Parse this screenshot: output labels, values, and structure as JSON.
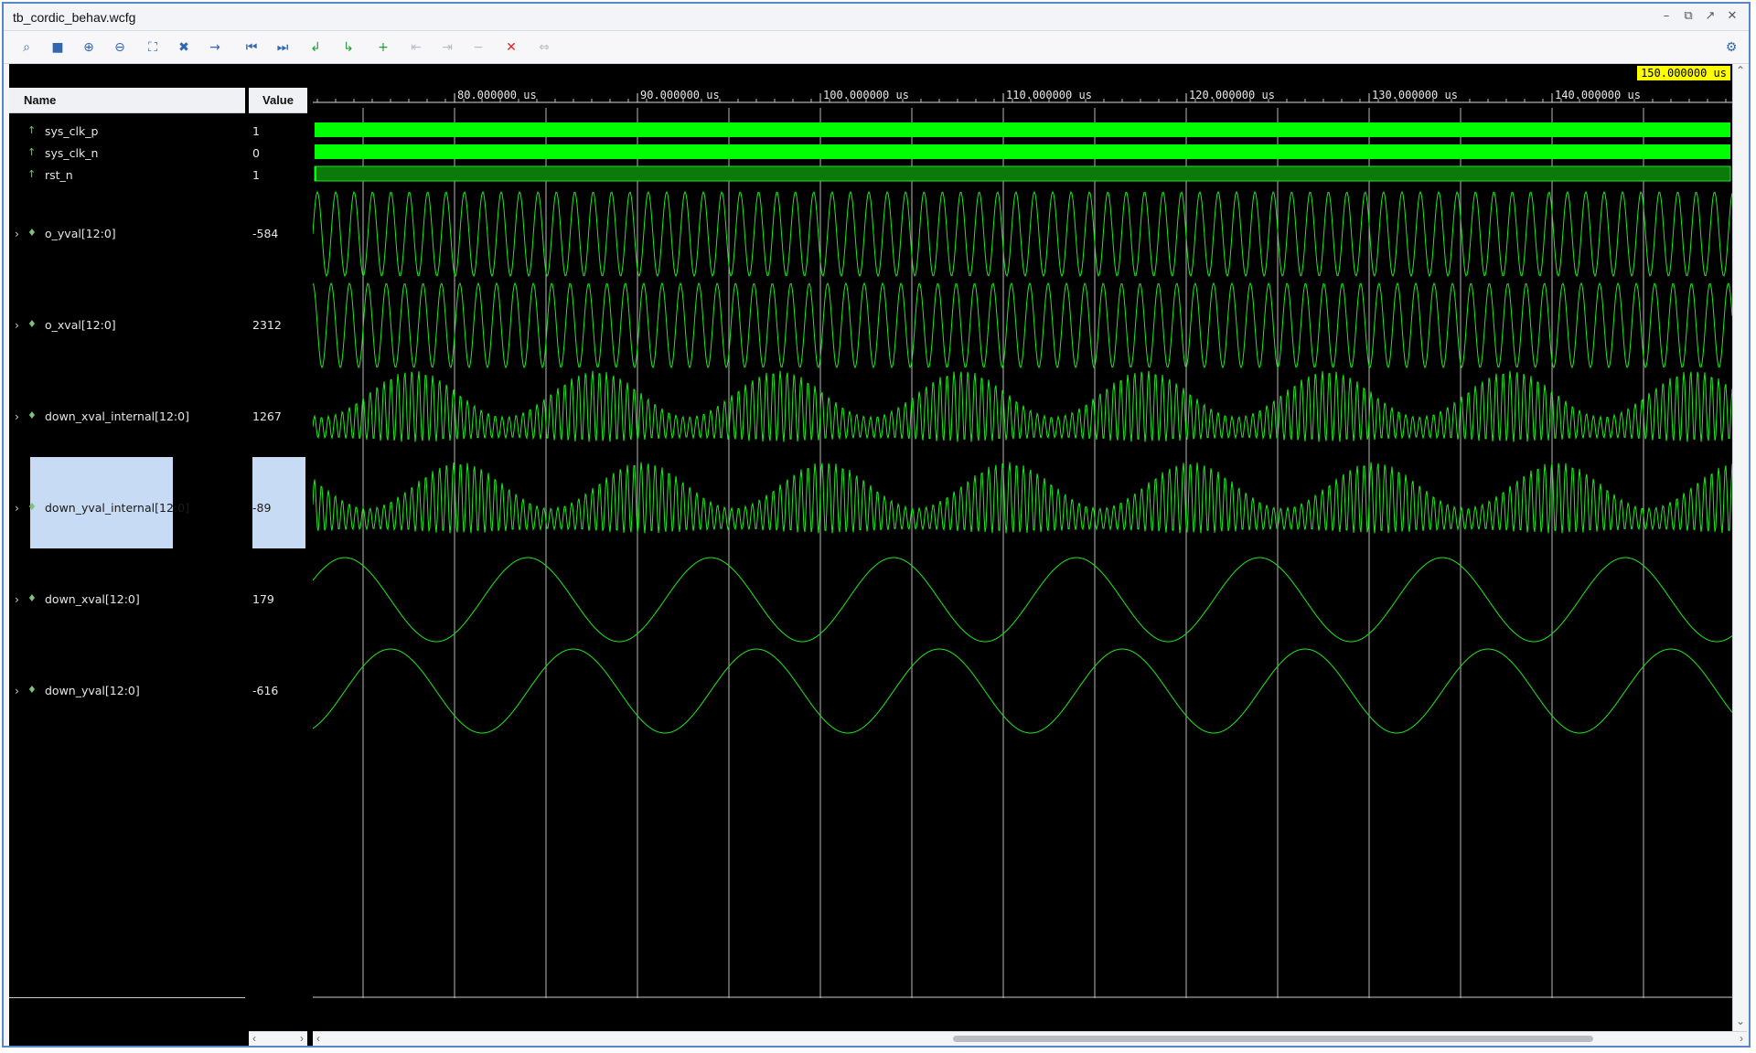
{
  "window": {
    "title": "tb_cordic_behav.wcfg",
    "minimize": "–",
    "restore": "⧉",
    "float": "↗",
    "close": "✕"
  },
  "toolbar": {
    "items": [
      {
        "name": "search-icon",
        "glyph": "⌕"
      },
      {
        "name": "save-icon",
        "glyph": "■"
      },
      {
        "name": "zoom-in-icon",
        "glyph": "⊕"
      },
      {
        "name": "zoom-out-icon",
        "glyph": "⊖"
      },
      {
        "name": "zoom-fit-icon",
        "glyph": "⛶"
      },
      {
        "name": "cursor-icon",
        "glyph": "✖"
      },
      {
        "name": "go-to-cursor-icon",
        "glyph": "→"
      },
      {
        "name": "go-to-start-icon",
        "glyph": "⏮"
      },
      {
        "name": "go-to-end-icon",
        "glyph": "⏭"
      },
      {
        "name": "previous-transition-icon",
        "glyph": "↲"
      },
      {
        "name": "next-transition-icon",
        "glyph": "↳"
      },
      {
        "name": "add-marker-icon",
        "glyph": "+"
      },
      {
        "name": "previous-marker-icon",
        "glyph": "⇤"
      },
      {
        "name": "next-marker-icon",
        "glyph": "⇥"
      },
      {
        "name": "marker-icon",
        "glyph": "−"
      },
      {
        "name": "delete-marker-icon",
        "glyph": "✕"
      },
      {
        "name": "swap-cursors-icon",
        "glyph": "⇔"
      }
    ],
    "settings_icon": "⚙"
  },
  "panes": {
    "name_header": "Name",
    "value_header": "Value"
  },
  "signals": [
    {
      "name": "sys_clk_p",
      "value": "1",
      "expandable": false,
      "kind": "clock"
    },
    {
      "name": "sys_clk_n",
      "value": "0",
      "expandable": false,
      "kind": "clock"
    },
    {
      "name": "rst_n",
      "value": "1",
      "expandable": false,
      "kind": "reset"
    },
    {
      "name": "o_yval[12:0]",
      "value": "-584",
      "expandable": true,
      "kind": "analog-fast"
    },
    {
      "name": "o_xval[12:0]",
      "value": "2312",
      "expandable": true,
      "kind": "analog-fast"
    },
    {
      "name": "down_xval_internal[12:0]",
      "value": "1267",
      "expandable": true,
      "kind": "analog-am"
    },
    {
      "name": "down_yval_internal[12:0]",
      "value": "-89",
      "expandable": true,
      "kind": "analog-am",
      "selected": true
    },
    {
      "name": "down_xval[12:0]",
      "value": "179",
      "expandable": true,
      "kind": "analog-slow"
    },
    {
      "name": "down_yval[12:0]",
      "value": "-616",
      "expandable": true,
      "kind": "analog-slow"
    }
  ],
  "timeline": {
    "unit": "us",
    "labels": [
      "80.000000 us",
      "90.000000 us",
      "100.000000 us",
      "110.000000 us",
      "120.000000 us",
      "130.000000 us",
      "140.000000 us"
    ],
    "cursor_label": "150.000000 us"
  },
  "colors": {
    "wave": "#1ee81e",
    "clock_fill": "#00ff00",
    "cursor_badge": "#ffff00"
  }
}
